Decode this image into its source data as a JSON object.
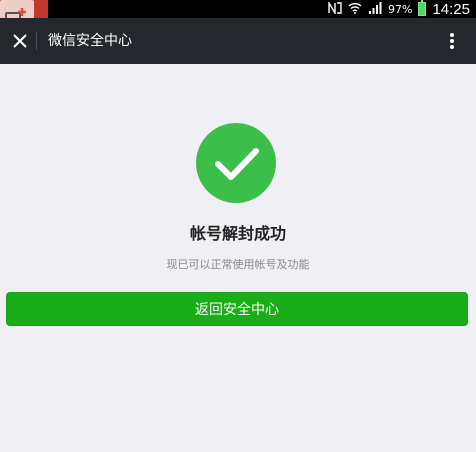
{
  "status_bar": {
    "battery_percent": "97%",
    "time": "14:25",
    "icons": [
      "nfc-icon",
      "wifi-icon",
      "signal-icon",
      "battery-icon"
    ]
  },
  "nav": {
    "title": "微信安全中心",
    "close_icon": "close-icon",
    "more_icon": "more-vertical-icon"
  },
  "result": {
    "icon": "checkmark-circle-icon",
    "title": "帐号解封成功",
    "description": "现已可以正常使用帐号及功能"
  },
  "action": {
    "primary_label": "返回安全中心"
  },
  "colors": {
    "status_bar_bg": "#000000",
    "nav_bg": "#24282d",
    "page_bg": "#efeff4",
    "success_green": "#3cbe4a",
    "button_green": "#1aad19"
  }
}
